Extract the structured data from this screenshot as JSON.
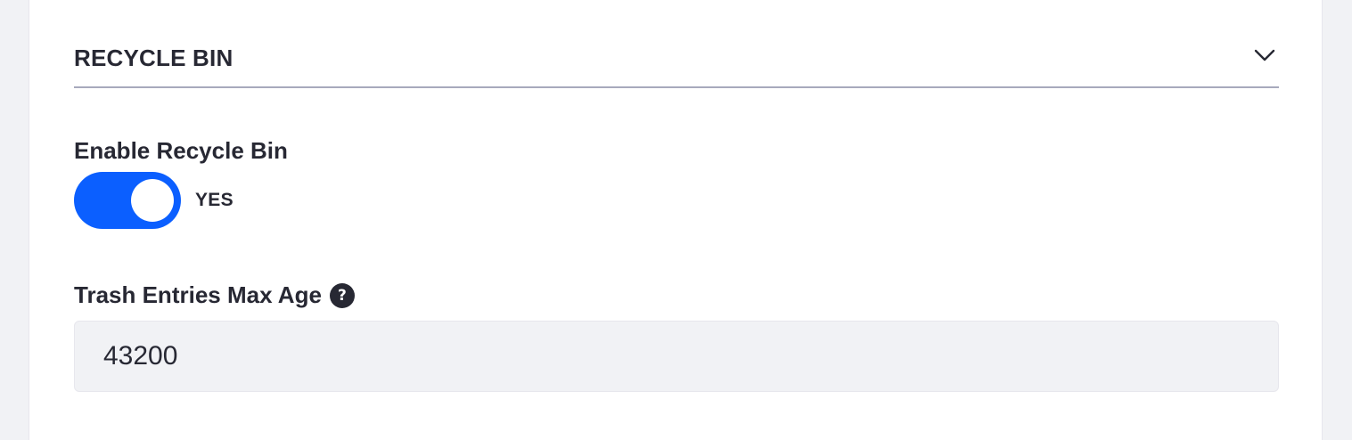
{
  "section": {
    "title": "RECYCLE BIN",
    "toggle_icon": "chevron-down-icon"
  },
  "recycle_bin": {
    "label": "Enable Recycle Bin",
    "enabled": true,
    "state_text": "YES"
  },
  "max_age": {
    "label": "Trash Entries Max Age",
    "help_icon": "question-circle-icon",
    "help_glyph": "?",
    "value": "43200"
  },
  "colors": {
    "accent": "#0b5fff",
    "text": "#272833",
    "input_bg": "#f1f2f5",
    "page_bg": "#f1f2f5",
    "divider": "#a7a9bc"
  }
}
